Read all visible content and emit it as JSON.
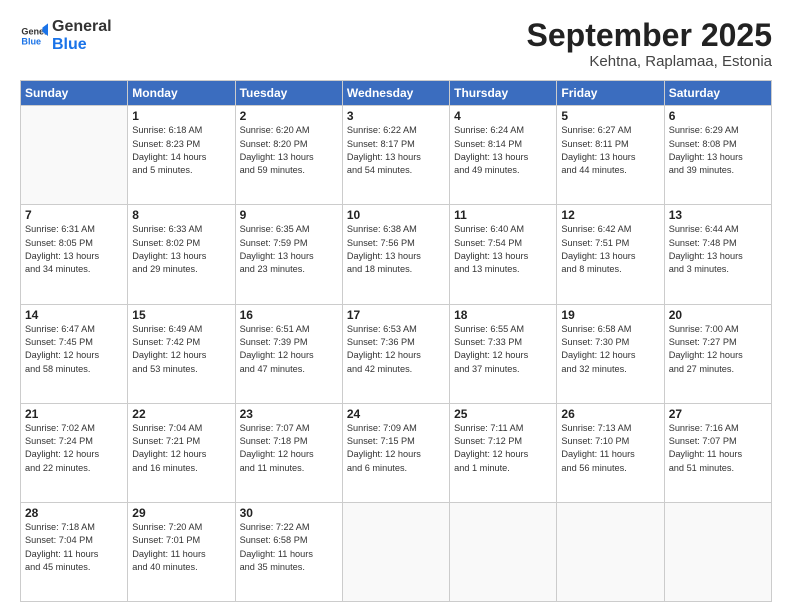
{
  "logo": {
    "line1": "General",
    "line2": "Blue"
  },
  "title": "September 2025",
  "location": "Kehtna, Raplamaa, Estonia",
  "header_days": [
    "Sunday",
    "Monday",
    "Tuesday",
    "Wednesday",
    "Thursday",
    "Friday",
    "Saturday"
  ],
  "weeks": [
    [
      {
        "day": "",
        "info": ""
      },
      {
        "day": "1",
        "info": "Sunrise: 6:18 AM\nSunset: 8:23 PM\nDaylight: 14 hours\nand 5 minutes."
      },
      {
        "day": "2",
        "info": "Sunrise: 6:20 AM\nSunset: 8:20 PM\nDaylight: 13 hours\nand 59 minutes."
      },
      {
        "day": "3",
        "info": "Sunrise: 6:22 AM\nSunset: 8:17 PM\nDaylight: 13 hours\nand 54 minutes."
      },
      {
        "day": "4",
        "info": "Sunrise: 6:24 AM\nSunset: 8:14 PM\nDaylight: 13 hours\nand 49 minutes."
      },
      {
        "day": "5",
        "info": "Sunrise: 6:27 AM\nSunset: 8:11 PM\nDaylight: 13 hours\nand 44 minutes."
      },
      {
        "day": "6",
        "info": "Sunrise: 6:29 AM\nSunset: 8:08 PM\nDaylight: 13 hours\nand 39 minutes."
      }
    ],
    [
      {
        "day": "7",
        "info": "Sunrise: 6:31 AM\nSunset: 8:05 PM\nDaylight: 13 hours\nand 34 minutes."
      },
      {
        "day": "8",
        "info": "Sunrise: 6:33 AM\nSunset: 8:02 PM\nDaylight: 13 hours\nand 29 minutes."
      },
      {
        "day": "9",
        "info": "Sunrise: 6:35 AM\nSunset: 7:59 PM\nDaylight: 13 hours\nand 23 minutes."
      },
      {
        "day": "10",
        "info": "Sunrise: 6:38 AM\nSunset: 7:56 PM\nDaylight: 13 hours\nand 18 minutes."
      },
      {
        "day": "11",
        "info": "Sunrise: 6:40 AM\nSunset: 7:54 PM\nDaylight: 13 hours\nand 13 minutes."
      },
      {
        "day": "12",
        "info": "Sunrise: 6:42 AM\nSunset: 7:51 PM\nDaylight: 13 hours\nand 8 minutes."
      },
      {
        "day": "13",
        "info": "Sunrise: 6:44 AM\nSunset: 7:48 PM\nDaylight: 13 hours\nand 3 minutes."
      }
    ],
    [
      {
        "day": "14",
        "info": "Sunrise: 6:47 AM\nSunset: 7:45 PM\nDaylight: 12 hours\nand 58 minutes."
      },
      {
        "day": "15",
        "info": "Sunrise: 6:49 AM\nSunset: 7:42 PM\nDaylight: 12 hours\nand 53 minutes."
      },
      {
        "day": "16",
        "info": "Sunrise: 6:51 AM\nSunset: 7:39 PM\nDaylight: 12 hours\nand 47 minutes."
      },
      {
        "day": "17",
        "info": "Sunrise: 6:53 AM\nSunset: 7:36 PM\nDaylight: 12 hours\nand 42 minutes."
      },
      {
        "day": "18",
        "info": "Sunrise: 6:55 AM\nSunset: 7:33 PM\nDaylight: 12 hours\nand 37 minutes."
      },
      {
        "day": "19",
        "info": "Sunrise: 6:58 AM\nSunset: 7:30 PM\nDaylight: 12 hours\nand 32 minutes."
      },
      {
        "day": "20",
        "info": "Sunrise: 7:00 AM\nSunset: 7:27 PM\nDaylight: 12 hours\nand 27 minutes."
      }
    ],
    [
      {
        "day": "21",
        "info": "Sunrise: 7:02 AM\nSunset: 7:24 PM\nDaylight: 12 hours\nand 22 minutes."
      },
      {
        "day": "22",
        "info": "Sunrise: 7:04 AM\nSunset: 7:21 PM\nDaylight: 12 hours\nand 16 minutes."
      },
      {
        "day": "23",
        "info": "Sunrise: 7:07 AM\nSunset: 7:18 PM\nDaylight: 12 hours\nand 11 minutes."
      },
      {
        "day": "24",
        "info": "Sunrise: 7:09 AM\nSunset: 7:15 PM\nDaylight: 12 hours\nand 6 minutes."
      },
      {
        "day": "25",
        "info": "Sunrise: 7:11 AM\nSunset: 7:12 PM\nDaylight: 12 hours\nand 1 minute."
      },
      {
        "day": "26",
        "info": "Sunrise: 7:13 AM\nSunset: 7:10 PM\nDaylight: 11 hours\nand 56 minutes."
      },
      {
        "day": "27",
        "info": "Sunrise: 7:16 AM\nSunset: 7:07 PM\nDaylight: 11 hours\nand 51 minutes."
      }
    ],
    [
      {
        "day": "28",
        "info": "Sunrise: 7:18 AM\nSunset: 7:04 PM\nDaylight: 11 hours\nand 45 minutes."
      },
      {
        "day": "29",
        "info": "Sunrise: 7:20 AM\nSunset: 7:01 PM\nDaylight: 11 hours\nand 40 minutes."
      },
      {
        "day": "30",
        "info": "Sunrise: 7:22 AM\nSunset: 6:58 PM\nDaylight: 11 hours\nand 35 minutes."
      },
      {
        "day": "",
        "info": ""
      },
      {
        "day": "",
        "info": ""
      },
      {
        "day": "",
        "info": ""
      },
      {
        "day": "",
        "info": ""
      }
    ]
  ]
}
